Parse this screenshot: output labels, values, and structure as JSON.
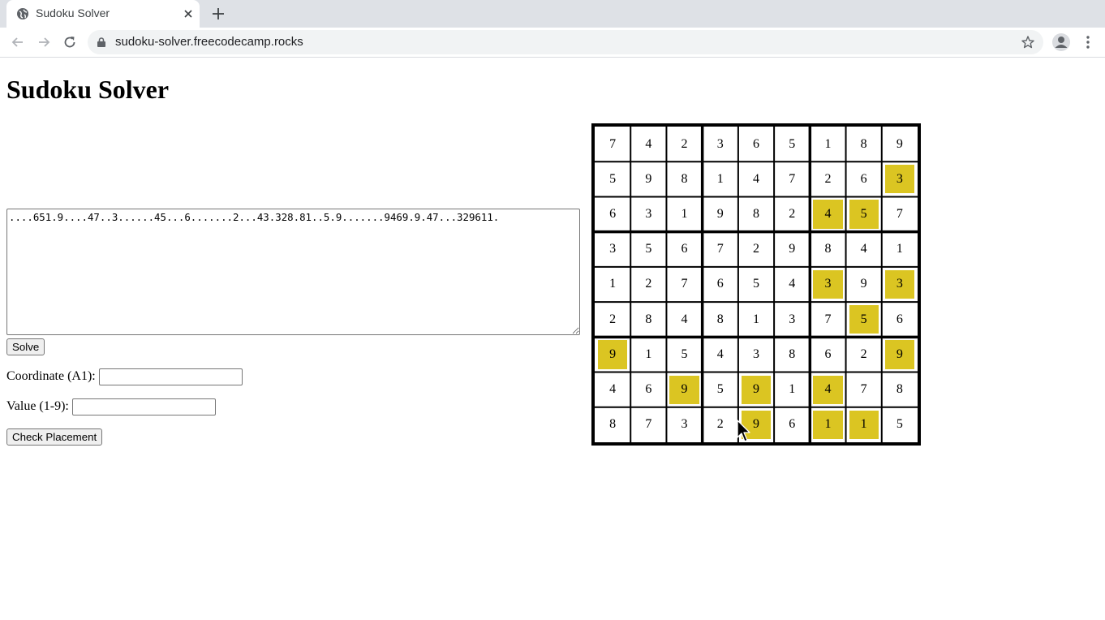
{
  "browser": {
    "tab_title": "Sudoku Solver",
    "url": "sudoku-solver.freecodecamp.rocks"
  },
  "page": {
    "title": "Sudoku Solver",
    "puzzle_input": "....651.9....47..3......45...6.......2...43.328.81..5.9.......9469.9.47...329611.",
    "solve_label": "Solve",
    "coordinate_label": "Coordinate (A1):",
    "coordinate_value": "",
    "value_label": "Value (1-9):",
    "value_value": "",
    "check_label": "Check Placement"
  },
  "sudoku": {
    "rows": [
      [
        "7",
        "4",
        "2",
        "3",
        "6",
        "5",
        "1",
        "8",
        "9"
      ],
      [
        "5",
        "9",
        "8",
        "1",
        "4",
        "7",
        "2",
        "6",
        "3"
      ],
      [
        "6",
        "3",
        "1",
        "9",
        "8",
        "2",
        "4",
        "5",
        "7"
      ],
      [
        "3",
        "5",
        "6",
        "7",
        "2",
        "9",
        "8",
        "4",
        "1"
      ],
      [
        "1",
        "2",
        "7",
        "6",
        "5",
        "4",
        "3",
        "9",
        "3"
      ],
      [
        "2",
        "8",
        "4",
        "8",
        "1",
        "3",
        "7",
        "5",
        "6"
      ],
      [
        "9",
        "1",
        "5",
        "4",
        "3",
        "8",
        "6",
        "2",
        "9"
      ],
      [
        "4",
        "6",
        "9",
        "5",
        "9",
        "1",
        "4",
        "7",
        "8"
      ],
      [
        "8",
        "7",
        "3",
        "2",
        "9",
        "6",
        "1",
        "1",
        "5"
      ]
    ],
    "highlighted": [
      [
        1,
        8
      ],
      [
        2,
        6
      ],
      [
        2,
        7
      ],
      [
        4,
        6
      ],
      [
        4,
        8
      ],
      [
        5,
        7
      ],
      [
        6,
        0
      ],
      [
        6,
        8
      ],
      [
        7,
        2
      ],
      [
        7,
        4
      ],
      [
        7,
        6
      ],
      [
        8,
        4
      ],
      [
        8,
        6
      ],
      [
        8,
        7
      ]
    ],
    "highlight_color": "#dbc522"
  }
}
